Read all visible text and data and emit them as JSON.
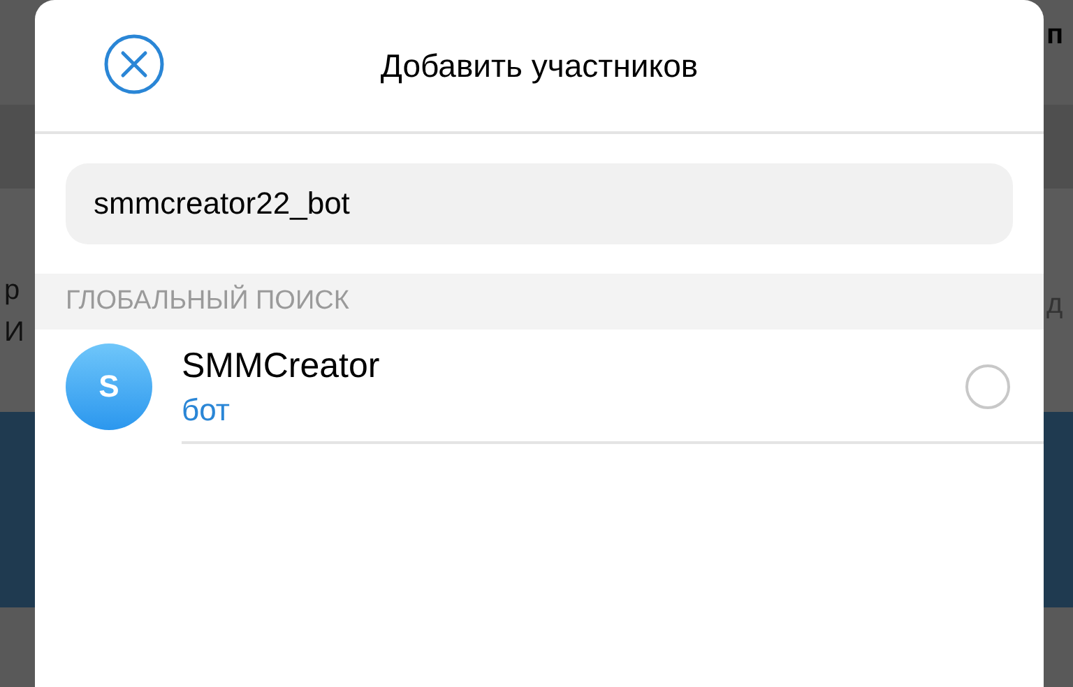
{
  "background": {
    "left_texts": [
      "р",
      "И"
    ],
    "right_texts": [
      "п",
      "д"
    ]
  },
  "dialog": {
    "title": "Добавить участников",
    "search": {
      "value": "smmcreator22_bot"
    },
    "section": "ГЛОБАЛЬНЫЙ ПОИСК",
    "results": [
      {
        "initial": "S",
        "name": "SMMCreator",
        "subtitle": "бот",
        "selected": false
      }
    ]
  }
}
